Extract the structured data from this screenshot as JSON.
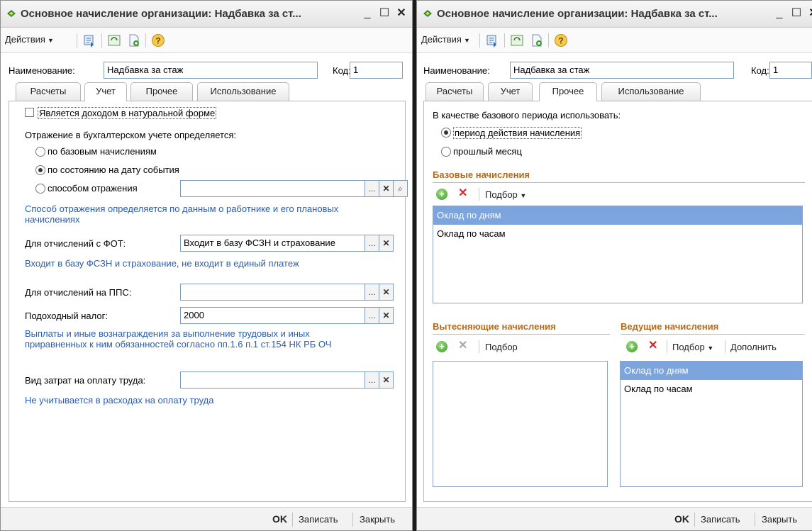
{
  "left": {
    "title": "Основное начисление организации: Надбавка за ст...",
    "toolbar": {
      "actions": "Действия"
    },
    "name_label": "Наименование:",
    "name_value": "Надбавка за стаж",
    "code_label": "Код:",
    "code_value": "1",
    "tabs": [
      "Расчеты",
      "Учет",
      "Прочее",
      "Использование"
    ],
    "active_tab": "Учет",
    "natural_form": "Является доходом в натуральной форме",
    "reflection_title": "Отражение в бухгалтерском учете определяется:",
    "radio1": "по базовым начислениям",
    "radio2": "по состоянию на дату события",
    "radio3": "способом отражения",
    "hint1_line1": "Способ отражения определяется по данным о работнике и его плановых",
    "hint1_line2": "начислениях",
    "fot_label": "Для отчислений с ФОТ:",
    "fot_value": "Входит в базу ФСЗН и страхование",
    "hint2": "Входит в базу ФСЗН и страхование, не входит в единый платеж",
    "pps_label": "Для отчислений на ППС:",
    "tax_label": "Подоходный налог:",
    "tax_value": "2000",
    "hint3_line1": "Выплаты и иные вознаграждения за выполнение трудовых и иных",
    "hint3_line2": "приравненных к ним обязанностей согласно пп.1.6 п.1 ст.154 НК РБ ОЧ",
    "cost_label": "Вид затрат на оплату труда:",
    "hint4": "Не учитывается в расходах на оплату труда",
    "footer": {
      "ok": "OK",
      "save": "Записать",
      "close": "Закрыть"
    }
  },
  "right": {
    "title": "Основное начисление организации: Надбавка за ст...",
    "toolbar": {
      "actions": "Действия"
    },
    "name_label": "Наименование:",
    "name_value": "Надбавка за стаж",
    "code_label": "Код:",
    "code_value": "1",
    "tabs": [
      "Расчеты",
      "Учет",
      "Прочее",
      "Использование"
    ],
    "active_tab": "Прочее",
    "period_title": "В качестве базового периода использовать:",
    "period_radio1": "период действия начисления",
    "period_radio2": "прошлый месяц",
    "base_section": "Базовые начисления",
    "base_pick": "Подбор",
    "base_items": [
      "Оклад по дням",
      "Оклад по часам"
    ],
    "displacing_section": "Вытесняющие начисления",
    "displacing_pick": "Подбор",
    "leading_section": "Ведущие начисления",
    "leading_pick": "Подбор",
    "leading_add": "Дополнить",
    "leading_items": [
      "Оклад по дням",
      "Оклад по часам"
    ],
    "footer": {
      "ok": "OK",
      "save": "Записать",
      "close": "Закрыть"
    }
  }
}
